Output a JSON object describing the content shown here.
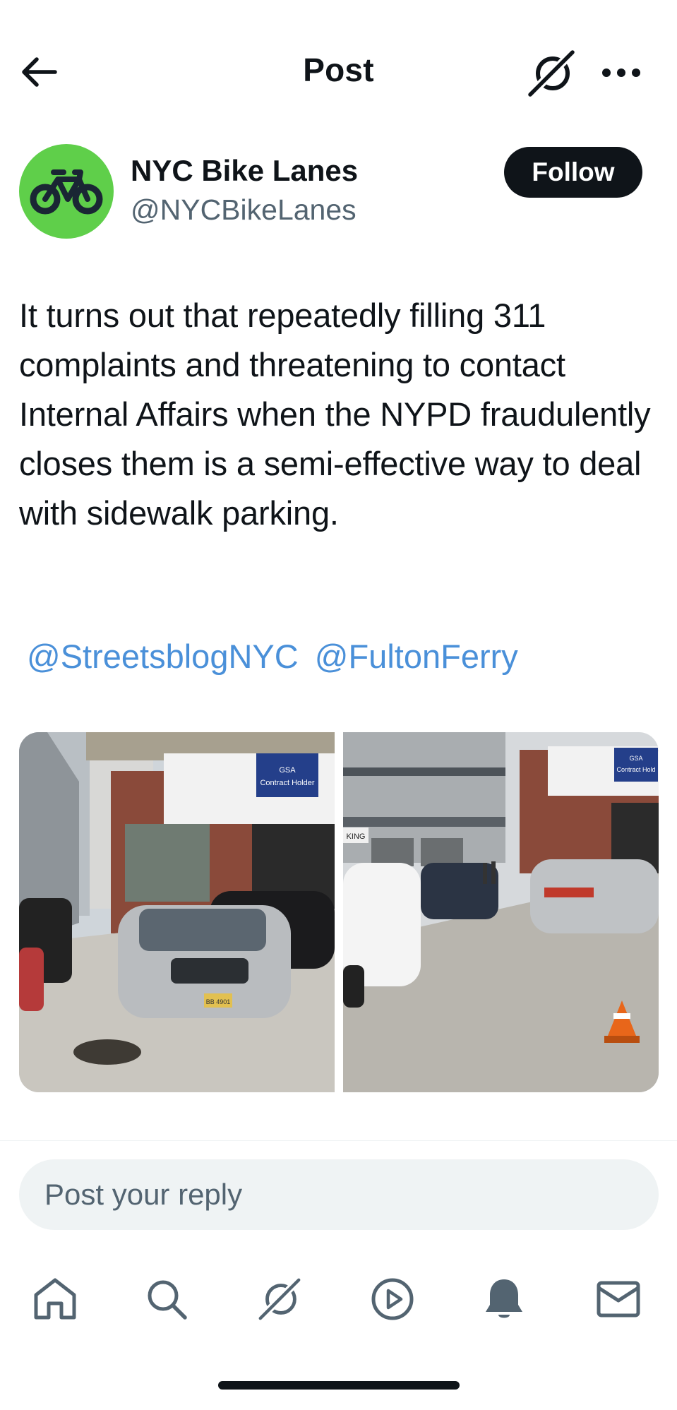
{
  "header": {
    "title": "Post",
    "back_icon": "arrow-left-icon",
    "grok_icon": "grok-icon",
    "more_icon": "more-horizontal-icon"
  },
  "author": {
    "name": "NYC Bike Lanes",
    "handle": "@NYCBikeLanes",
    "avatar_icon": "bicycle-icon",
    "avatar_bg": "#5fcf4a",
    "follow_label": "Follow"
  },
  "tweet": {
    "text": "It turns out that repeatedly filling 311 complaints and threatening to contact Internal Affairs when the NYPD fraudulently closes them is a semi-effective way to deal with sidewalk parking.",
    "mentions": [
      "@StreetsblogNYC",
      "@FultonFerry"
    ],
    "mention_color": "#4a90d9",
    "photos": [
      {
        "sign_top": "GSA",
        "sign_bottom": "Contract Holder",
        "plate": "BB 4901"
      },
      {
        "sign_top": "GSA",
        "sign_bottom": "Contract Hold",
        "storefront": "KING"
      }
    ]
  },
  "reply": {
    "placeholder": "Post your reply"
  },
  "nav": {
    "items": [
      {
        "icon": "home-icon"
      },
      {
        "icon": "search-icon"
      },
      {
        "icon": "grok-icon"
      },
      {
        "icon": "play-icon"
      },
      {
        "icon": "bell-icon"
      },
      {
        "icon": "mail-icon"
      }
    ]
  },
  "colors": {
    "text_primary": "#0f1419",
    "text_secondary": "#536471",
    "input_bg": "#eff3f4"
  }
}
